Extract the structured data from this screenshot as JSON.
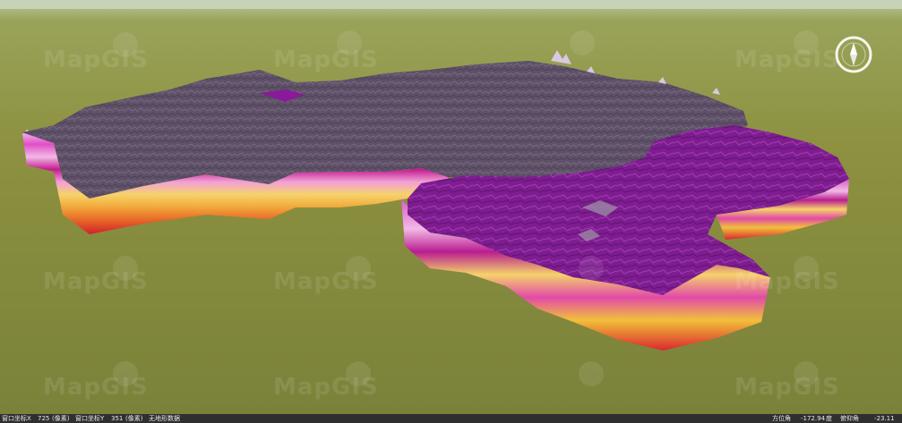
{
  "watermark": "MapGIS",
  "status": {
    "window_x_label": "窗口坐标X",
    "window_x_value": "725",
    "window_x_unit": "(像素)",
    "window_y_label": "窗口坐标Y",
    "window_y_value": "351",
    "window_y_unit": "(像素)",
    "no_data": "无地形数据",
    "azimuth_label": "方位角",
    "azimuth_value": "-172.94",
    "azimuth_unit": "度",
    "pitch_label": "俯仰角",
    "pitch_value": "-23.11"
  },
  "colors": {
    "ground": "#7f8a3c",
    "sky": "#b9c9a0",
    "surface_grey": "#5b4e66",
    "surface_purple": "#8a1a9a",
    "strata": [
      "#f1b9e6",
      "#e04fc7",
      "#c41c8e",
      "#f5d36a",
      "#f2a83a",
      "#e23c2a"
    ]
  }
}
